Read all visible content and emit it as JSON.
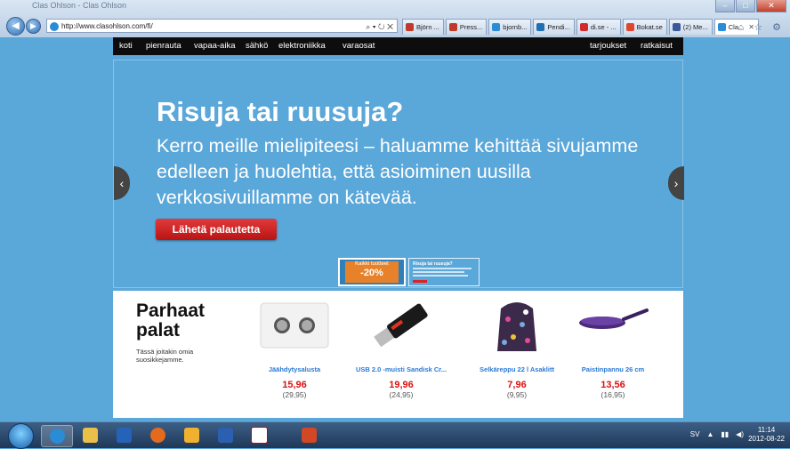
{
  "browser": {
    "window_title": "Clas Ohlson - Clas Ohlson",
    "address": "http://www.clasohlson.com/fi/",
    "address_tools": "⌕ ▾ ↻ ✕",
    "tabs": [
      {
        "label": "Björn ...",
        "color": "#c0392b"
      },
      {
        "label": "Press...",
        "color": "#c0392b"
      },
      {
        "label": "bjornb...",
        "color": "#2a8bd6"
      },
      {
        "label": "Pendi...",
        "color": "#1f6fb2"
      },
      {
        "label": "di.se - ...",
        "color": "#d12b2b"
      },
      {
        "label": "Bokat.se",
        "color": "#e0462d"
      },
      {
        "label": "(2) Me...",
        "color": "#3b5998"
      },
      {
        "label": "Cla...",
        "color": "#2a8bd6",
        "active": true
      }
    ],
    "right_icons": "⌂ ☆ ⚙"
  },
  "nav": {
    "items": [
      "koti",
      "pienrauta",
      "vapaa-aika",
      "sähkö",
      "elektroniikka",
      "varaosat"
    ],
    "right_items": [
      "tarjoukset",
      "ratkaisut"
    ]
  },
  "hero": {
    "title": "Risuja tai ruusuja?",
    "body": "Kerro meille mielipiteesi – haluamme kehittää sivujamme edelleen ja huolehtia, että asioiminen uusilla verkkosivuillamme on kätevää.",
    "button": "Lähetä palautetta",
    "left_arrow": "‹",
    "right_arrow": "›",
    "thumb1": {
      "top": "Kaikki tuotteet",
      "pct": "-20%"
    },
    "thumb2": {
      "title": "Risuja tai ruusuja?"
    }
  },
  "products": {
    "title": "Parhaat palat",
    "subtitle": "Tässä joitakin omia suosikkejamme.",
    "items": [
      {
        "name": "Jäähdytysalusta",
        "price": "15,96",
        "old": "(29,95)"
      },
      {
        "name": "USB 2.0 -muisti Sandisk Cr...",
        "price": "19,96",
        "old": "(24,95)"
      },
      {
        "name": "Selkäreppu 22 l Asaklitt",
        "price": "7,96",
        "old": "(9,95)"
      },
      {
        "name": "Paistinpannu 26 cm",
        "price": "13,56",
        "old": "(16,95)"
      }
    ]
  },
  "taskbar": {
    "lang": "SV",
    "time": "11:14",
    "date": "2012-08-22"
  }
}
